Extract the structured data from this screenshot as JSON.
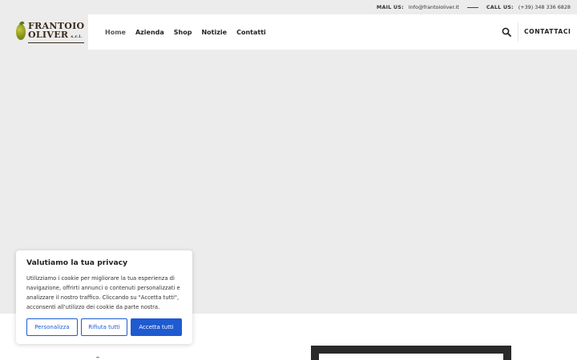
{
  "topbar": {
    "mail_label": "MAIL US:",
    "mail_value": "info@frantoioliver.it",
    "call_label": "CALL US:",
    "call_value": "(+39) 348 336 6828"
  },
  "logo": {
    "line1": "FRANTOIO",
    "line2": "OLIVER",
    "suffix": "s.r.l."
  },
  "nav": {
    "items": [
      {
        "label": "Home",
        "active": true
      },
      {
        "label": "Azienda"
      },
      {
        "label": "Shop"
      },
      {
        "label": "Notizie"
      },
      {
        "label": "Contatti"
      }
    ],
    "search_icon": "search-icon",
    "cta_label": "CONTATTACI"
  },
  "cookie": {
    "title": "Valutiamo la tua privacy",
    "text": "Utilizziamo i cookie per migliorare la tua esperienza di navigazione, offrirti annunci o contenuti personalizzati e analizzare il nostro traffico. Cliccando su \"Accetta tutti\", acconsenti all'utilizzo dei cookie da parte nostra.",
    "customize_label": "Personalizza",
    "reject_label": "Rifiuta tutti",
    "accept_label": "Accetta tutti"
  },
  "colors": {
    "accent": "#1e5bd1",
    "background": "#ececec",
    "dark_block": "#2a2a2a"
  }
}
